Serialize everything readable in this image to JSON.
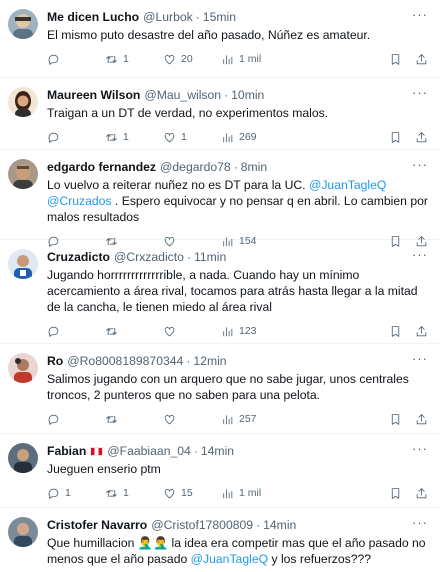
{
  "tweets": [
    {
      "name": "Me dicen Lucho",
      "handle": "@Lurbok",
      "time": "15min",
      "text_parts": [
        "El mismo puto desastre del año pasado, Núñez es amateur."
      ],
      "replies": "",
      "retweets": "",
      "likes": "20",
      "views": "1 mil",
      "avatar_color": "#8fa6b5"
    },
    {
      "name": "Maureen Wilson",
      "handle": "@Mau_wilson",
      "time": "10min",
      "text_parts": [
        "Traigan a un DT de verdad, no experimentos malos."
      ],
      "replies": "",
      "retweets": "",
      "likes": "1",
      "views": "269",
      "avatar_color": "#c8a27a"
    },
    {
      "name": "edgardo fernandez",
      "handle": "@degardo78",
      "time": "8min",
      "text_parts": [
        "Lo vuelvo a reiterar nuñez no es DT para la UC.  ",
        "@JuanTagleQ",
        " ",
        "@Cruzados",
        " . Espero equivocar y no pensar q en abril.  Lo cambien por malos resultados"
      ],
      "replies": "",
      "retweets": "",
      "likes": "",
      "views": "154",
      "avatar_color": "#7a6a58"
    },
    {
      "name": "Cruzadicto",
      "handle": "@Crxzadicto",
      "time": "11min",
      "text_parts": [
        "Jugando horrrrrrrrrrrrrible, a nada. Cuando hay un mínimo acercamiento a área rival, tocamos para atrás hasta llegar a la mitad de la cancha, le tienen miedo al área rival"
      ],
      "replies": "",
      "retweets": "",
      "likes": "",
      "views": "123",
      "avatar_color": "#3b6fb0"
    },
    {
      "name": "Ro",
      "handle": "@Ro80081898703 44",
      "handle_full": "@Ro8008189870344",
      "time": "12min",
      "text_parts": [
        "Salimos jugando con un arquero que no sabe jugar, unos centrales troncos, 2 punteros que no saben para una pelota."
      ],
      "replies": "",
      "retweets": "",
      "likes": "",
      "views": "257",
      "avatar_color": "#c0392b"
    },
    {
      "name": "Fabian",
      "handle": "@Faabiaan_04",
      "time": "14min",
      "text_parts": [
        "Jueguen enserio ptm"
      ],
      "replies": "1",
      "retweets": "",
      "likes": "15",
      "views": "1 mil",
      "avatar_color": "#4a5a6a"
    },
    {
      "name": "Cristofer Navarro",
      "handle": "@Cristof17800809",
      "time": "14min",
      "text_parts": [
        "Que humillacion 🤦‍♂️🤦‍♂️ la idea era competir mas que el año pasado no menos que el año pasado ",
        "@JuanTagleQ",
        "  y los refuerzos???"
      ],
      "replies": "",
      "retweets": "",
      "likes": "",
      "views": "",
      "avatar_color": "#6d7f8e"
    }
  ],
  "retweet_counts": [
    "1",
    "1"
  ],
  "ui": {
    "more": "···",
    "dot": "·"
  },
  "icons": [
    "reply-icon",
    "retweet-icon",
    "like-icon",
    "views-icon",
    "bookmark-icon",
    "share-icon"
  ]
}
